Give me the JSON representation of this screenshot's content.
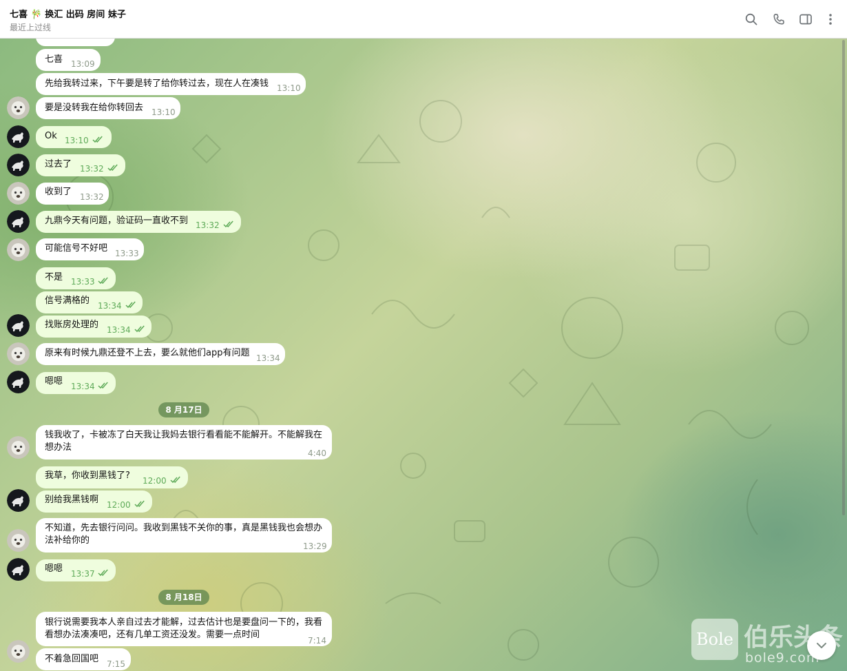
{
  "header": {
    "title": "七喜 🎋 换汇 出码 房间 妹子",
    "status": "最近上过线",
    "icons": [
      "search-icon",
      "phone-icon",
      "sidebar-toggle-icon",
      "more-vert-icon"
    ]
  },
  "messages": [
    {
      "text": "七喜",
      "time": "13:09",
      "dir": "in"
    },
    {
      "text": "先给我转过来，下午要是转了给你转过去，现在人在凑钱",
      "time": "13:10",
      "dir": "in"
    },
    {
      "text": "要是没转我在给你转回去",
      "time": "13:10",
      "dir": "in"
    },
    {
      "text": "Ok",
      "time": "13:10",
      "dir": "out",
      "read": true
    },
    {
      "text": "过去了",
      "time": "13:32",
      "dir": "out",
      "read": true
    },
    {
      "text": "收到了",
      "time": "13:32",
      "dir": "in"
    },
    {
      "text": "九鼎今天有问题，验证码一直收不到",
      "time": "13:32",
      "dir": "out",
      "read": true
    },
    {
      "text": "可能信号不好吧",
      "time": "13:33",
      "dir": "in"
    },
    {
      "text": "不是",
      "time": "13:33",
      "dir": "out",
      "read": true
    },
    {
      "text": "信号满格的",
      "time": "13:34",
      "dir": "out",
      "read": true
    },
    {
      "text": "找账房处理的",
      "time": "13:34",
      "dir": "out",
      "read": true
    },
    {
      "text": "原来有时候九鼎还登不上去，要么就他们app有问题",
      "time": "13:34",
      "dir": "in"
    },
    {
      "text": "嗯嗯",
      "time": "13:34",
      "dir": "out",
      "read": true
    },
    {
      "text": "钱我收了，卡被冻了白天我让我妈去银行看看能不能解开。不能解我在",
      "text2": "想办法",
      "time": "4:40",
      "dir": "in"
    },
    {
      "text": "我草，你收到黑钱了?",
      "time": "12:00",
      "dir": "out",
      "read": true
    },
    {
      "text": "别给我黑钱啊",
      "time": "12:00",
      "dir": "out",
      "read": true
    },
    {
      "text": "不知道，先去银行问问。我收到黑钱不关你的事，真是黑钱我也会想办",
      "text2": "法补给你的",
      "time": "13:29",
      "dir": "in"
    },
    {
      "text": "嗯嗯",
      "time": "13:37",
      "dir": "out",
      "read": true
    },
    {
      "text": "银行说需要我本人亲自过去才能解，过去估计也是要盘问一下的，我看",
      "text2": "看想办法凑凑吧，还有几单工资还没发。需要一点时间",
      "time": "7:14",
      "dir": "in"
    },
    {
      "text": "不着急回国吧",
      "time": "7:15",
      "dir": "in"
    }
  ],
  "dates": [
    "8 月17日",
    "8 月18日"
  ],
  "watermark": {
    "logo": "Bole",
    "name": "伯乐头条",
    "url": "bole9.com"
  },
  "scroll_down_icon": "chevron-down-icon",
  "colors": {
    "incoming": "#ffffff",
    "outgoing": "#effdde",
    "tick": "#5eaa58",
    "date_pill": "#608650"
  }
}
